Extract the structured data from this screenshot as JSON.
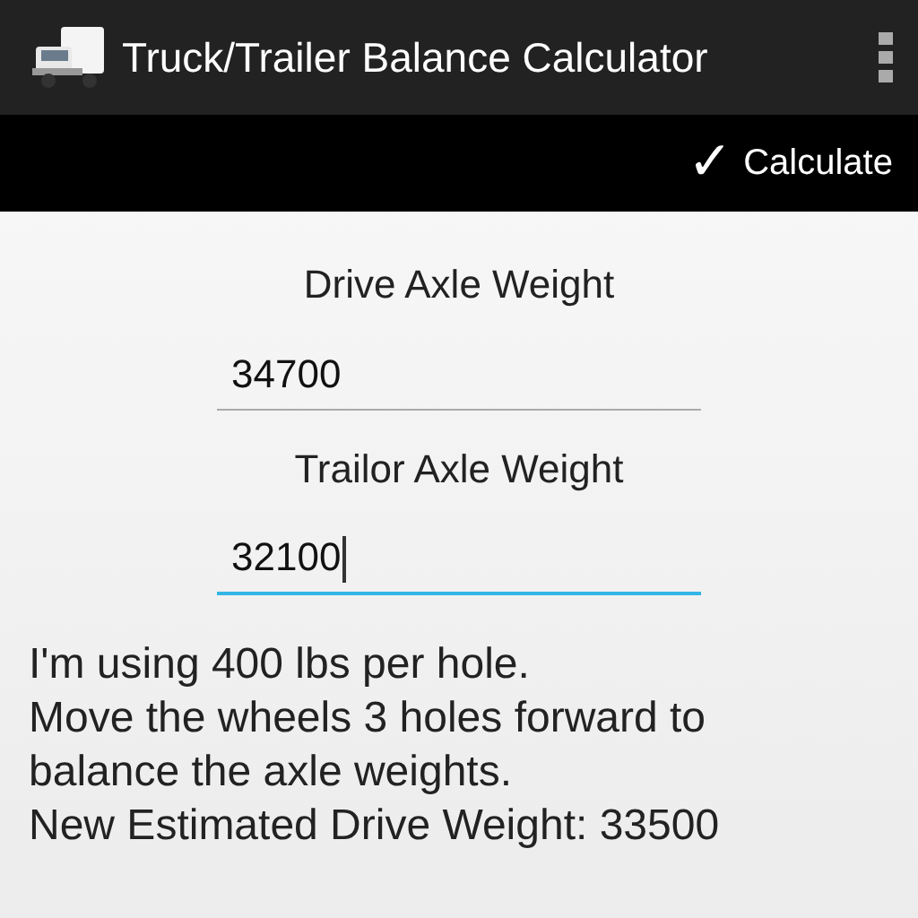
{
  "app_bar": {
    "title": "Truck/Trailer Balance Calculator"
  },
  "action_bar": {
    "action": {
      "icon": "✓",
      "label": "Calculate"
    }
  },
  "fields": [
    {
      "label": "Drive Axle Weight",
      "value": "34700",
      "focused": false
    },
    {
      "label": "Trailor Axle Weight",
      "value": "32100",
      "focused": true
    }
  ],
  "result_lines": [
    "I'm using 400 lbs per hole.",
    "Move the wheels 3 holes forward to",
    "balance the axle weights.",
    "New Estimated Drive Weight: 33500"
  ]
}
